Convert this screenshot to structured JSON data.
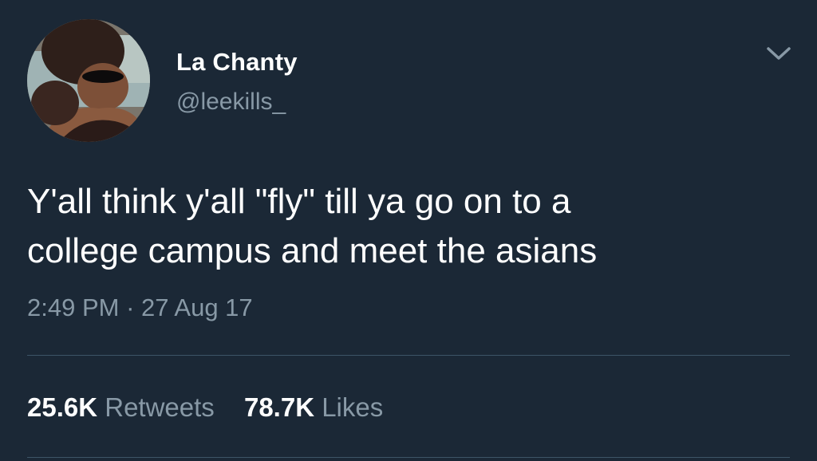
{
  "user": {
    "display_name": "La Chanty",
    "handle": "@leekills_"
  },
  "tweet": {
    "text": "Y'all think y'all \"fly\" till ya go on to a\ncollege campus and meet the asians",
    "time": "2:49 PM",
    "separator": "·",
    "date": "27 Aug 17"
  },
  "stats": {
    "retweets_count": "25.6K",
    "retweets_label": "Retweets",
    "likes_count": "78.7K",
    "likes_label": "Likes"
  },
  "icons": {
    "menu": "chevron-down-icon"
  },
  "colors": {
    "background": "#1b2836",
    "primary_text": "#ffffff",
    "secondary_text": "#8899a6",
    "divider": "#3d5466"
  }
}
